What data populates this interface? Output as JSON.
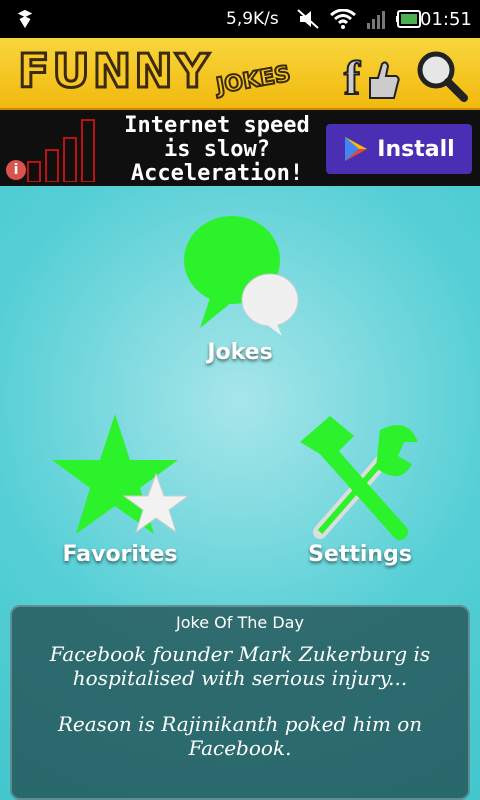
{
  "status_bar": {
    "network_speed": "5,9K/s",
    "time": "01:51",
    "icons": [
      "notification-icon",
      "mute-icon",
      "wifi-icon",
      "signal-icon",
      "battery-icon"
    ]
  },
  "header": {
    "logo_main": "FUNNY",
    "logo_sub": "JOKES"
  },
  "ad": {
    "message_line1": "Internet speed",
    "message_line2": "is slow?",
    "message_line3": "Acceleration!",
    "install_label": "Install"
  },
  "menu": {
    "jokes_label": "Jokes",
    "favorites_label": "Favorites",
    "settings_label": "Settings"
  },
  "joke_of_the_day": {
    "title": "Joke Of The Day",
    "line1": "Facebook founder Mark Zukerburg is hospitalised with serious injury...",
    "line2": "Reason is Rajinikanth poked him on Facebook."
  },
  "colors": {
    "accent_yellow": "#f3c21e",
    "background_teal": "#4fd0d6",
    "icon_green": "#2cf22c",
    "ad_button": "#4a2fb5"
  }
}
